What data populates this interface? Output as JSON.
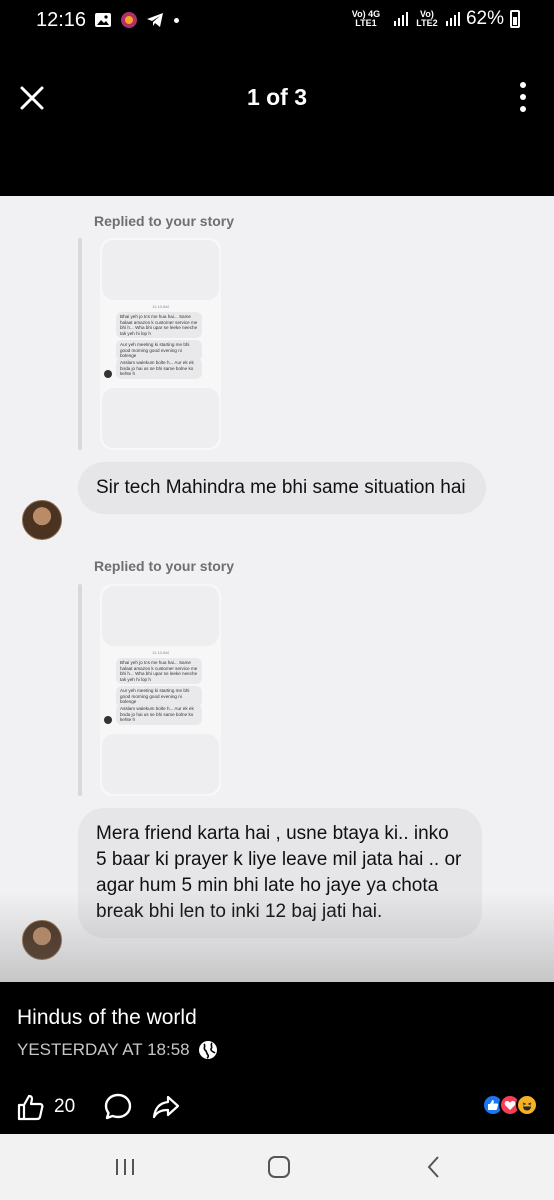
{
  "status_bar": {
    "time": "12:16",
    "sim1": "Vo) 4G LTE1",
    "sim2": "Vo) LTE2",
    "battery": "62%"
  },
  "header": {
    "counter": "1 of 3"
  },
  "screenshot": {
    "replied_label_1": "Replied to your story",
    "replied_label_2": "Replied to your story",
    "story_preview": {
      "time": "11:13 AM",
      "msg1": "Bhai yeh jo tcs me hua hai... Same halaat amazon k customer service me bhi h... Wha bhi upar se leeke neeche tak yeh hi lop h",
      "msg2": "Aur yeh meeting ki starting me bhi good morning good evening ni bolenge",
      "msg3": "Asslam walekum bolte h... Aur ek ek bnda jo hai us se bhi same bolne ko kehte h"
    },
    "message_1": "Sir tech Mahindra me bhi same situation hai",
    "message_2": "Mera friend karta hai , usne btaya ki.. inko 5 baar ki prayer k liye leave mil jata hai .. or agar hum 5 min bhi late ho jaye ya chota break bhi len to inki 12 baj jati hai."
  },
  "caption": {
    "page_name": "Hindus of the world",
    "date": "YESTERDAY AT 18:58",
    "like_count": "20"
  },
  "icons": {
    "close": "close-icon",
    "more": "more-vertical-icon",
    "like": "thumbs-up-icon",
    "comment": "comment-icon",
    "share": "share-icon",
    "globe": "globe-icon"
  }
}
